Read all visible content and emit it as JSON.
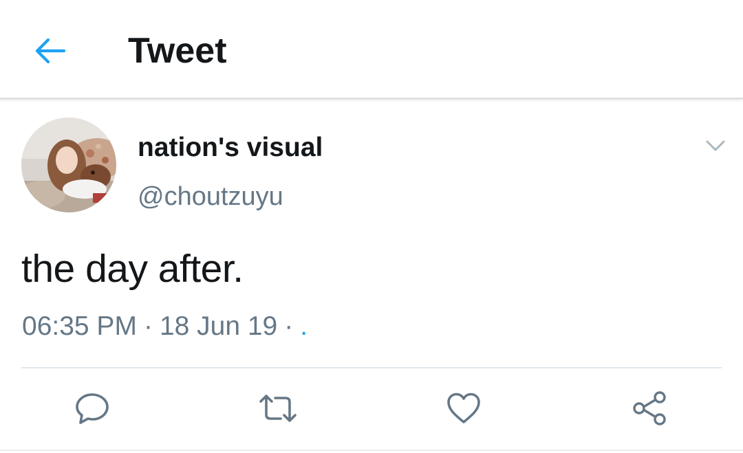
{
  "header": {
    "title": "Tweet",
    "back_icon": "arrow-left-icon"
  },
  "tweet": {
    "display_name": "nation's visual",
    "handle": "@choutzuyu",
    "text": "the day after.",
    "time": "06:35 PM",
    "date": "18 Jun 19",
    "separator": "·",
    "source": "."
  },
  "actions": [
    {
      "name": "reply",
      "icon": "reply-icon"
    },
    {
      "name": "retweet",
      "icon": "retweet-icon"
    },
    {
      "name": "like",
      "icon": "heart-icon"
    },
    {
      "name": "share",
      "icon": "share-icon"
    }
  ],
  "colors": {
    "accent": "#1da1f2",
    "text_primary": "#14171a",
    "text_secondary": "#657786",
    "icon_gray": "#657786",
    "divider": "#e1e8ed"
  }
}
